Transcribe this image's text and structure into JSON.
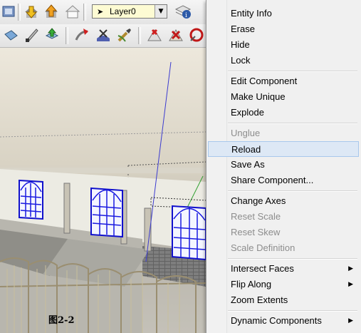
{
  "toolbar": {
    "layer_value": "Layer0",
    "icons_row1": [
      "components-icon",
      "download-model-icon",
      "upload-model-icon",
      "warehouse-icon",
      "layers-arrow-icon",
      "layer-manager-icon"
    ],
    "icons_row2": [
      "push-pull-icon",
      "knife-icon",
      "extrude-icon",
      "follow-me-icon",
      "sandbox-icon",
      "brush-icon",
      "add-detail-icon",
      "flip-edge-icon",
      "smoove-icon"
    ]
  },
  "viewport": {
    "caption": "图2-2"
  },
  "context_menu": {
    "items": [
      {
        "label": "Entity Info",
        "enabled": true
      },
      {
        "label": "Erase",
        "enabled": true
      },
      {
        "label": "Hide",
        "enabled": true
      },
      {
        "label": "Lock",
        "enabled": true
      },
      {
        "label": "Edit Component",
        "enabled": true
      },
      {
        "label": "Make Unique",
        "enabled": true
      },
      {
        "label": "Explode",
        "enabled": true
      },
      {
        "label": "Unglue",
        "enabled": false
      },
      {
        "label": "Reload",
        "enabled": true,
        "highlighted": true
      },
      {
        "label": "Save As",
        "enabled": true
      },
      {
        "label": "Share Component...",
        "enabled": true
      },
      {
        "label": "Change Axes",
        "enabled": true
      },
      {
        "label": "Reset Scale",
        "enabled": false
      },
      {
        "label": "Reset Skew",
        "enabled": false
      },
      {
        "label": "Scale Definition",
        "enabled": false
      },
      {
        "label": "Intersect Faces",
        "enabled": true,
        "submenu": true
      },
      {
        "label": "Flip Along",
        "enabled": true,
        "submenu": true
      },
      {
        "label": "Zoom Extents",
        "enabled": true
      },
      {
        "label": "Dynamic Components",
        "enabled": true,
        "submenu": true
      }
    ]
  }
}
